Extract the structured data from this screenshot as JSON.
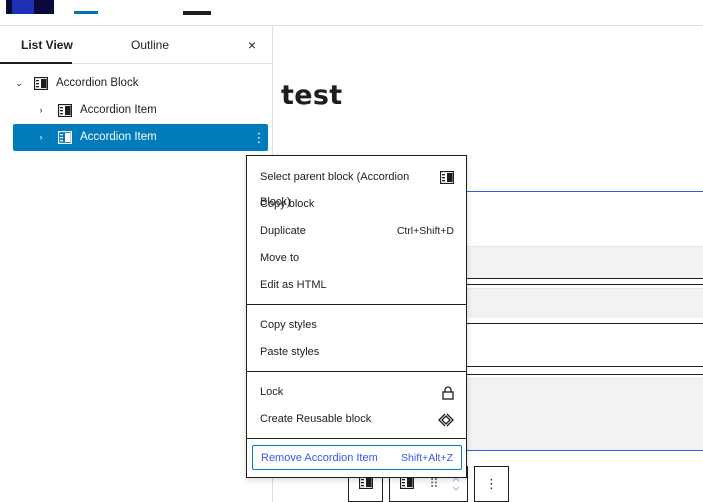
{
  "sidebar": {
    "tabs": {
      "list_view": "List View",
      "outline": "Outline"
    },
    "close_glyph": "×",
    "tree": [
      {
        "label": "Accordion Block",
        "chevron": "⌄"
      },
      {
        "label": "Accordion Item",
        "chevron": "›"
      },
      {
        "label": "Accordion Item",
        "chevron": "›",
        "more": "⋮"
      }
    ]
  },
  "canvas": {
    "title": "test"
  },
  "context_menu": {
    "items": [
      {
        "label": "Select parent block (Accordion Block)",
        "icon": "block-icon"
      },
      {
        "label": "Copy block"
      },
      {
        "label": "Duplicate",
        "shortcut": "Ctrl+Shift+D"
      },
      {
        "label": "Move to"
      },
      {
        "label": "Edit as HTML"
      },
      {
        "label": "Copy styles"
      },
      {
        "label": "Paste styles"
      },
      {
        "label": "Lock",
        "icon": "lock-icon"
      },
      {
        "label": "Create Reusable block",
        "icon": "reusable-block-icon"
      },
      {
        "label": "Remove Accordion Item",
        "shortcut": "Shift+Alt+Z"
      }
    ]
  },
  "toolbar": {
    "more_glyph": "⋮",
    "drag_glyph": "⠿"
  },
  "colors": {
    "accent": "#007cba",
    "highlight": "#3858e9"
  }
}
